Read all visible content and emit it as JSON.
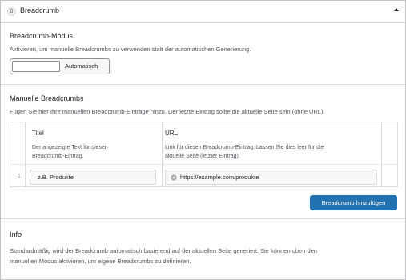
{
  "header": {
    "badge": "0",
    "title": "Breadcrumb"
  },
  "mode": {
    "title": "Breadcrumb-Modus",
    "description": "Aktivieren, um manuelle Breadcrumbs zu verwenden statt der automatischen Generierung.",
    "input_value": "",
    "button_label": "Automatisch"
  },
  "manual": {
    "title": "Manuelle Breadcrumbs",
    "description": "Fügen Sie hier Ihre manuellen Breadcrumb-Einträge hinzu. Der letzte Eintrag sollte die aktuelle Seite sein (ohne URL).",
    "columns": [
      {
        "label": "Titel",
        "desc1": "Der angezeigte Text für diesen",
        "desc2": "Breadcrumb-Eintrag."
      },
      {
        "label": "URL",
        "desc1": "Link für diesen Breadcrumb-Eintrag. Lassen Sie dies leer für die",
        "desc2": "aktuelle Seite (letzter Eintrag)."
      }
    ],
    "rows": [
      {
        "num": "1",
        "title_placeholder": "z.B. Produkte",
        "url_placeholder": "https://example.com/produkte"
      }
    ],
    "add_button": "Breadcrumb hinzufügen"
  },
  "info": {
    "title": "Info",
    "line1": "Standardmäßig wird der Breadcrumb automatisch basierend auf der aktuellen Seite generiert. Sie können oben den",
    "line2": "manuellen Modus aktivieren, um eigene Breadcrumbs zu definieren."
  },
  "colors": {
    "accent": "#2271b1",
    "border": "#dcdcde"
  },
  "icons": {
    "url_field": "globe-icon",
    "collapse": "arrow-up-icon"
  }
}
